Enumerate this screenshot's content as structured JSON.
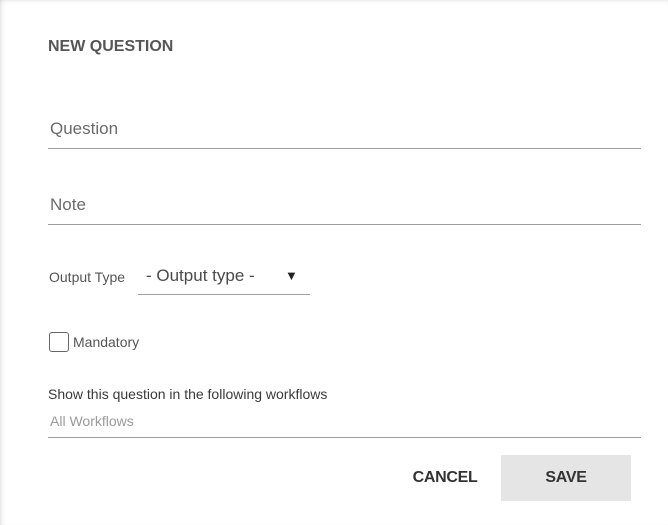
{
  "dialog": {
    "title": "NEW QUESTION",
    "question_placeholder": "Question",
    "note_placeholder": "Note",
    "output_type": {
      "label": "Output Type",
      "selected": "- Output type -",
      "arrow": "▼"
    },
    "mandatory": {
      "label": "Mandatory",
      "checked": false
    },
    "workflows": {
      "label": "Show this question in the following workflows",
      "placeholder": "All Workflows"
    },
    "buttons": {
      "cancel": "CANCEL",
      "save": "SAVE"
    }
  },
  "colors": {
    "save_button_bg": "#e5e5e5",
    "underline": "#9e9e9e"
  }
}
